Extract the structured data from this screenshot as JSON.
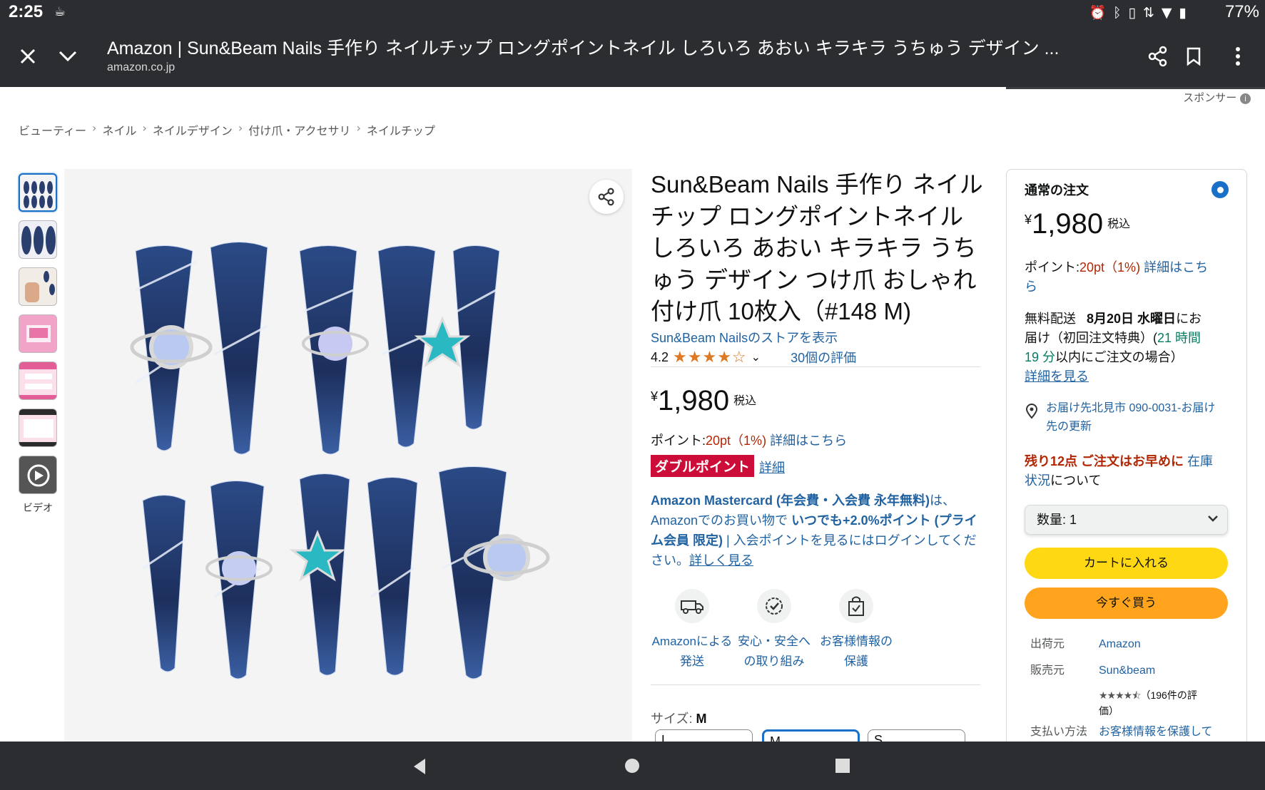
{
  "status_bar": {
    "time": "2:25",
    "battery": "77%",
    "icons": [
      "coffee-icon",
      "alarm-icon",
      "bluetooth-icon",
      "vibrate-icon",
      "data-icon",
      "wifi-icon",
      "battery-icon"
    ]
  },
  "toolbar": {
    "title": "Amazon | Sun&Beam Nails 手作り ネイルチップ ロングポイントネイル しろいろ あおい キラキラ うちゅう デザイン ...",
    "url": "amazon.co.jp"
  },
  "sponsor": "スポンサー",
  "breadcrumbs": [
    "ビューティー",
    "ネイル",
    "ネイルデザイン",
    "付け爪・アクセサリ",
    "ネイルチップ"
  ],
  "thumbnails": {
    "video_label": "ビデオ"
  },
  "product": {
    "title": "Sun&Beam Nails 手作り ネイルチップ ロングポイントネイル しろいろ あおい キラキラ うちゅう デザイン つけ爪 おしゃれ 付け爪 10枚入（#148 M)",
    "store_link": "Sun&Beam Nailsのストアを表示",
    "rating": "4.2",
    "rating_stars": 4.2,
    "review_count": "30個の評価",
    "price_symbol": "¥",
    "price": "1,980",
    "tax_label": "税込",
    "points_label": "ポイント:",
    "points_value": "20pt（1%)",
    "points_detail": "詳細はこちら",
    "double_point_badge": "ダブルポイント",
    "double_point_link": "詳細",
    "mastercard_bold": "Amazon Mastercard (年会費・入会費 永年無料)",
    "mastercard_t1": "は、Amazonでのお買い物で",
    "mastercard_bold2": "いつでも+2.0%ポイント (プライム会員 限定)",
    "mastercard_t2": " | 入会ポイントを見るにはログインしてください。",
    "mastercard_link": "詳しく見る",
    "features": [
      {
        "icon": "delivery-truck-icon",
        "line1": "Amazonによる",
        "line2": "発送"
      },
      {
        "icon": "secure-badge-icon",
        "line1": "安心・安全へ",
        "line2": "の取り組み"
      },
      {
        "icon": "shopping-bag-check-icon",
        "line1": "お客様情報の",
        "line2": "保護"
      }
    ],
    "size_label": "サイズ:",
    "size_value": "M",
    "size_options": [
      "L",
      "M",
      "S"
    ]
  },
  "buybox": {
    "order_type": "通常の注文",
    "price_symbol": "¥",
    "price": "1,980",
    "tax_label": "税込",
    "points_label": "ポイント:",
    "points_value": "20pt（1%)",
    "points_detail_1": "詳細はこち",
    "points_detail_2": "ら",
    "delivery_1": "無料配送",
    "delivery_date": "8月20日 水曜日",
    "delivery_2": "にお",
    "delivery_3": "届け（初回注文特典）(",
    "delivery_time_1": "21 時間",
    "delivery_time_2": "19 分",
    "delivery_4": "以内にご注文の場合）",
    "delivery_details": "詳細を見る",
    "location_1": "お届け先北見市 090-0031-お届け",
    "location_2": "先の更新",
    "stock_warning": "残り12点 ご注文はお早めに",
    "stock_link_1": "在庫",
    "stock_link_2": "状況",
    "stock_suffix": "について",
    "quantity_label": "数量: 1",
    "add_to_cart": "カートに入れる",
    "buy_now": "今すぐ買う",
    "ship_from_label": "出荷元",
    "ship_from_value": "Amazon",
    "seller_label": "販売元",
    "seller_value": "Sun&beam",
    "seller_rating": 4.5,
    "seller_rating_text_1": "（196件の評",
    "seller_rating_text_2": "価）",
    "payment_label": "支払い方法",
    "payment_value": "お客様情報を保護して"
  },
  "colors": {
    "accent": "#1a70c7",
    "link": "#2162a1",
    "price_orange": "#b12704",
    "cart_yellow": "#ffd814",
    "buy_orange": "#ffa41c",
    "double_point_red": "#cc0c39",
    "star": "#de7921"
  }
}
